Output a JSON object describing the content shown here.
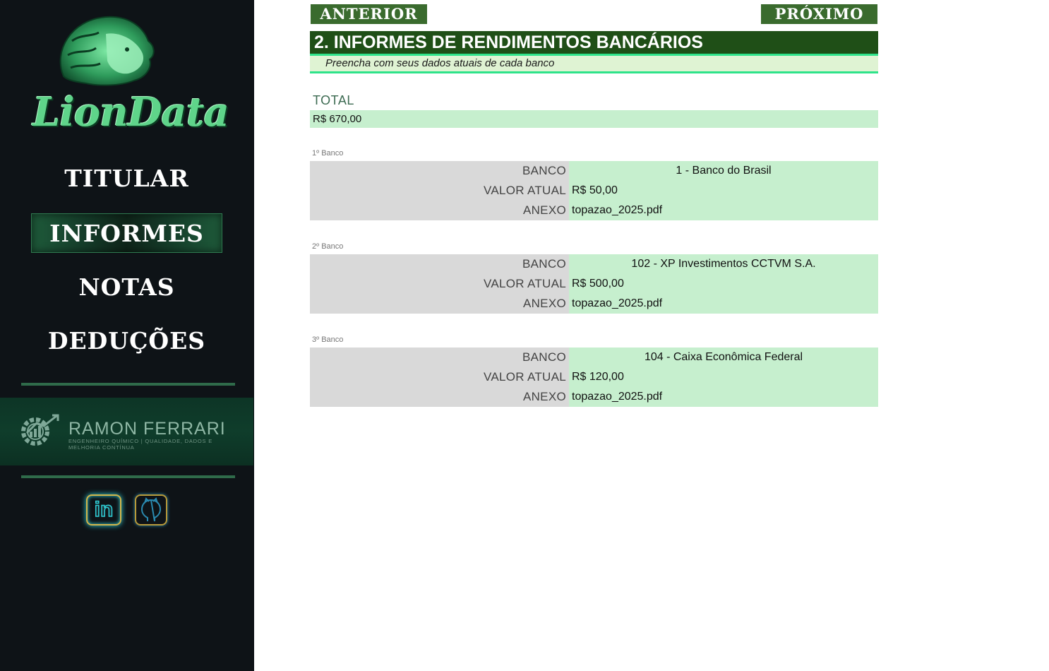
{
  "sidebar": {
    "logo_text": "LionData",
    "nav": [
      {
        "label": "TITULAR",
        "active": false
      },
      {
        "label": "INFORMES",
        "active": true
      },
      {
        "label": "NOTAS",
        "active": false
      },
      {
        "label": "DEDUÇÕES",
        "active": false
      }
    ],
    "brand": {
      "name": "RAMON FERRARI",
      "subtitle": "ENGENHEIRO QUÍMICO | QUALIDADE, DADOS E MELHORIA CONTÍNUA"
    },
    "social": [
      {
        "icon": "linkedin-icon",
        "label": "in"
      },
      {
        "icon": "github-icon"
      }
    ]
  },
  "toolbar": {
    "prev_label": "ANTERIOR",
    "next_label": "PRÓXIMO"
  },
  "section": {
    "title": "2. INFORMES DE RENDIMENTOS BANCÁRIOS",
    "subtitle": "Preencha com seus dados atuais de cada banco"
  },
  "total": {
    "label": "TOTAL",
    "value": "R$ 670,00"
  },
  "banks": [
    {
      "caption": "1º Banco",
      "rows": [
        {
          "key": "BANCO",
          "value": "1 - Banco do Brasil"
        },
        {
          "key": "VALOR ATUAL",
          "value": "R$ 50,00"
        },
        {
          "key": "ANEXO",
          "value": "topazao_2025.pdf"
        }
      ]
    },
    {
      "caption": "2º Banco",
      "rows": [
        {
          "key": "BANCO",
          "value": "102 - XP Investimentos CCTVM S.A."
        },
        {
          "key": "VALOR ATUAL",
          "value": "R$ 500,00"
        },
        {
          "key": "ANEXO",
          "value": "topazao_2025.pdf"
        }
      ]
    },
    {
      "caption": "3º Banco",
      "rows": [
        {
          "key": "BANCO",
          "value": "104 - Caixa Econômica Federal"
        },
        {
          "key": "VALOR ATUAL",
          "value": "R$ 120,00"
        },
        {
          "key": "ANEXO",
          "value": "topazao_2025.pdf"
        }
      ]
    }
  ],
  "colors": {
    "sidebar_bg": "#0e1317",
    "header_bg": "#1f4f17",
    "accent_line": "#2ee38a",
    "value_cell": "#c6efce",
    "key_cell": "#d9d9d9",
    "button_bg": "#3a6b2e"
  }
}
